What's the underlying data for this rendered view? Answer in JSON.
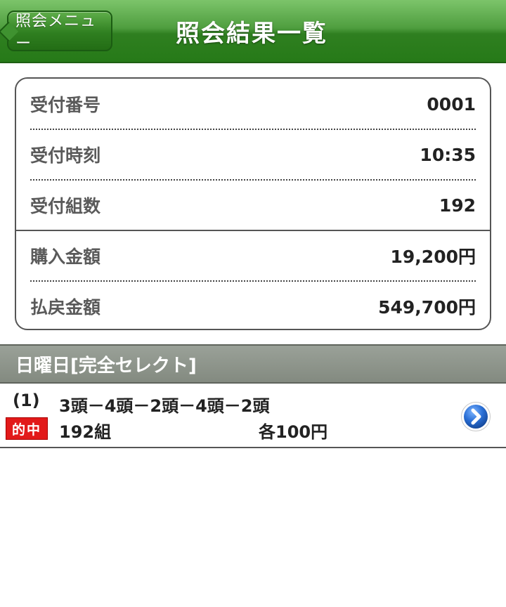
{
  "header": {
    "back_label": "照会メニュー",
    "title": "照会結果一覧"
  },
  "summary": {
    "reception_number": {
      "label": "受付番号",
      "value": "0001"
    },
    "reception_time": {
      "label": "受付時刻",
      "value": "10:35"
    },
    "reception_count": {
      "label": "受付組数",
      "value": "192"
    },
    "purchase_amount": {
      "label": "購入金額",
      "value": "19,200円"
    },
    "payout_amount": {
      "label": "払戻金額",
      "value": "549,700円"
    }
  },
  "section": {
    "title": "日曜日[完全セレクト]"
  },
  "results": [
    {
      "index": "(1)",
      "combination": "3頭－4頭－2頭－4頭－2頭",
      "badge": "的中",
      "count": "192組",
      "unit_price": "各100円"
    }
  ],
  "colors": {
    "header_green": "#2f7f20",
    "section_gray": "#8a9187",
    "hit_red": "#e21a1a",
    "arrow_blue": "#2a6fd6"
  },
  "icons": {
    "back": "chevron-left-icon",
    "detail": "chevron-right-circle-icon"
  }
}
